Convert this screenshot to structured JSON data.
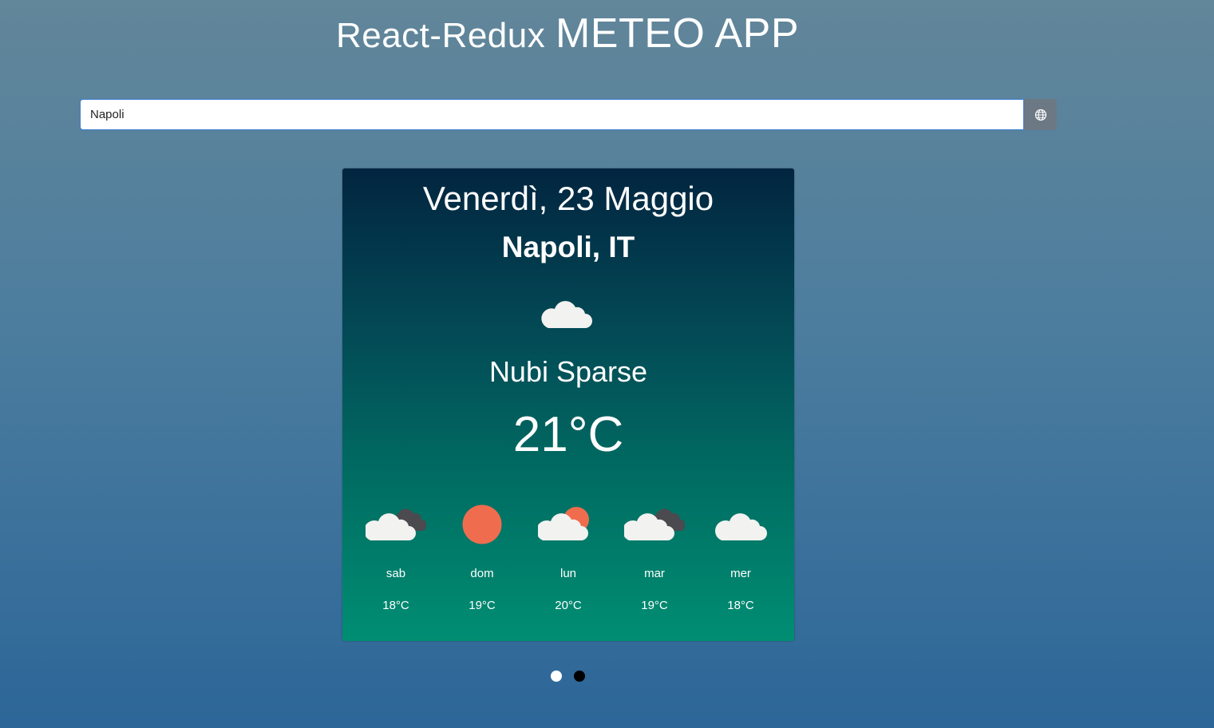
{
  "app": {
    "title_small": "React-Redux",
    "title_big": "METEO APP"
  },
  "search": {
    "value": "Napoli",
    "button_icon": "globe-icon"
  },
  "weather": {
    "date": "Venerdì, 23 Maggio",
    "city": "Napoli, IT",
    "icon": "cloud-icon",
    "description": "Nubi Sparse",
    "temperature": "21°C"
  },
  "forecast": [
    {
      "day": "sab",
      "temp": "18°C",
      "icon": "cloud-dark-cloud-icon"
    },
    {
      "day": "dom",
      "temp": "19°C",
      "icon": "sun-icon"
    },
    {
      "day": "lun",
      "temp": "20°C",
      "icon": "cloud-sun-icon"
    },
    {
      "day": "mar",
      "temp": "19°C",
      "icon": "cloud-dark-cloud-icon"
    },
    {
      "day": "mer",
      "temp": "18°C",
      "icon": "cloud-icon"
    }
  ],
  "carousel": {
    "active_index": 0,
    "count": 2
  },
  "colors": {
    "cloud": "#f2f2f0",
    "dark_cloud": "#4a4a4f",
    "sun": "#ef6d4e",
    "dot_active": "#ffffff",
    "dot_inactive": "#000000"
  }
}
